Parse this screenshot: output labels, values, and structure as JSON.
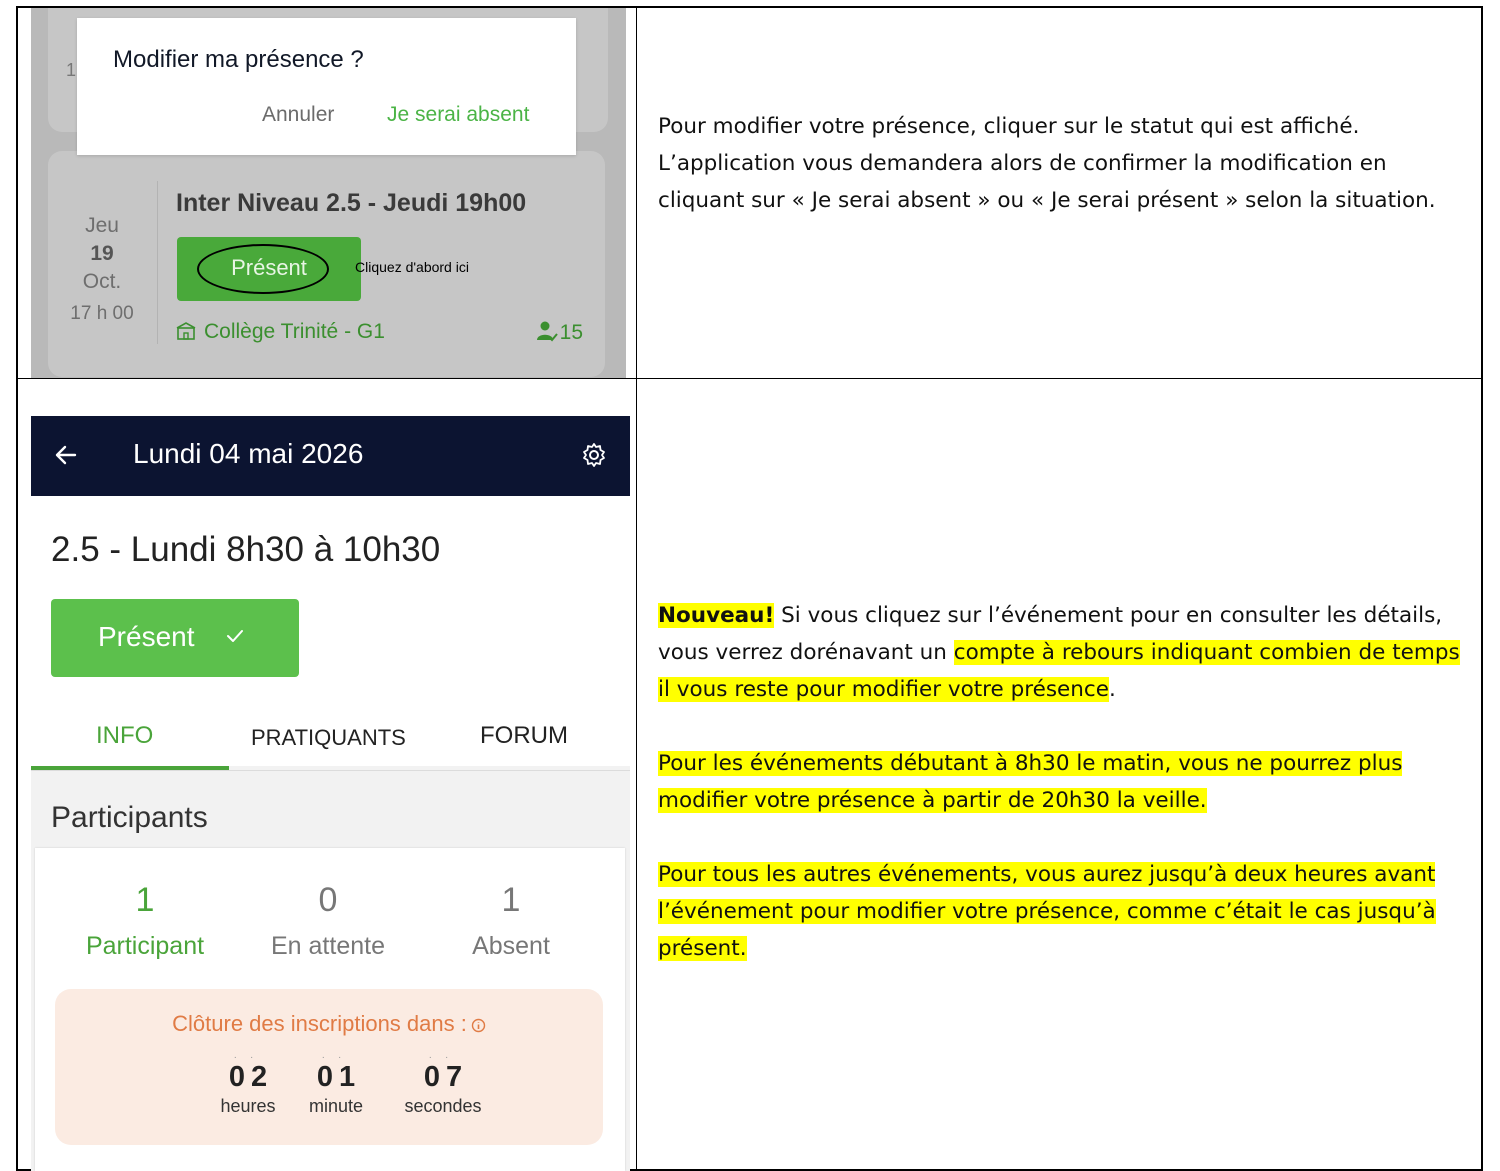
{
  "screen1": {
    "dialog": {
      "title": "Modifier ma présence ?",
      "cancel": "Annuler",
      "absent": "Je serai absent"
    },
    "event": {
      "day": "Jeu",
      "date": "19",
      "month": "Oct.",
      "time": "17 h 00",
      "title": "Inter Niveau 2.5 - Jeudi 19h00",
      "status": "Présent",
      "hint": "Cliquez d'abord ici",
      "location": "Collège Trinité - G1",
      "count": "15"
    },
    "partial_number": "1"
  },
  "screen2": {
    "header_title": "Lundi 04 mai 2026",
    "event_title": "2.5 - Lundi 8h30 à 10h30",
    "status": "Présent",
    "tabs": [
      "INFO",
      "PRATIQUANTS",
      "FORUM"
    ],
    "section_title": "Participants",
    "stats": [
      {
        "value": "1",
        "label": "Participant"
      },
      {
        "value": "0",
        "label": "En attente"
      },
      {
        "value": "1",
        "label": "Absent"
      }
    ],
    "countdown": {
      "title": "Clôture des inscriptions dans :",
      "hours": "02",
      "hours_label": "heures",
      "minutes": "01",
      "minutes_label": "minute",
      "seconds": "07",
      "seconds_label": "secondes"
    }
  },
  "text1": "Pour modifier votre présence, cliquer sur le statut qui est affiché. L’application vous demandera alors de confirmer la modification en cliquant sur « Je serai absent » ou « Je serai présent » selon la situation.",
  "text2": {
    "new_label": "Nouveau!",
    "p1_a": " Si vous cliquez sur l’événement pour en consulter les détails, vous verrez dorénavant un ",
    "p1_b": "compte à rebours indiquant combien de temps il vous reste pour modifier votre présence",
    "p1_c": ".",
    "p2": "Pour les événements débutant à 8h30 le matin, vous ne pourrez plus modifier votre présence à partir de 20h30 la veille.",
    "p3": "Pour tous les autres événements, vous aurez jusqu’à deux heures avant l’événement pour modifier votre présence, comme c’était le cas jusqu’à présent."
  },
  "colors": {
    "green": "#49a93a",
    "navy": "#0c1431",
    "highlight": "#ffff00",
    "orange": "#e07b45"
  }
}
